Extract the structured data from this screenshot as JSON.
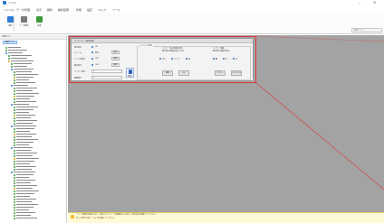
{
  "window": {
    "title": "ソフト",
    "minimize_glyph": "–",
    "close_glyph": "✕"
  },
  "menu": [
    "ファイル",
    "データ管理",
    "表示",
    "解析",
    "解析結果",
    "作図",
    "設定",
    "ヘルプ",
    "ツール"
  ],
  "ribbon": {
    "buttons": [
      {
        "label": "解析",
        "color": "#2e7bd6"
      },
      {
        "label": "データ確認",
        "color": "#7a7a7a"
      },
      {
        "label": "結果",
        "color": "#3c9a3c"
      }
    ],
    "right_box": "表示モード"
  },
  "tree": {
    "header": "全体モデル",
    "root_label": "解析モデル",
    "items": [
      {
        "indent": 2,
        "color": "#3c9a3c"
      },
      {
        "indent": 2,
        "color": "#3c9a3c"
      },
      {
        "indent": 2,
        "color": "#2e7bd6"
      },
      {
        "indent": 4,
        "color": "#3c9a3c"
      },
      {
        "indent": 4,
        "color": "#3c9a3c"
      },
      {
        "indent": 4,
        "color": "#d9a400"
      },
      {
        "indent": 6,
        "color": "#3c9a3c"
      },
      {
        "indent": 6,
        "color": "#3c9a3c"
      },
      {
        "indent": 6,
        "color": "#2e7bd6"
      },
      {
        "indent": 8,
        "color": "#3c9a3c"
      },
      {
        "indent": 8,
        "color": "#3c9a3c"
      },
      {
        "indent": 8,
        "color": "#d9a400"
      },
      {
        "indent": 8,
        "color": "#3c9a3c"
      },
      {
        "indent": 8,
        "color": "#3c9a3c"
      },
      {
        "indent": 6,
        "color": "#2e7bd6"
      },
      {
        "indent": 8,
        "color": "#3c9a3c"
      },
      {
        "indent": 8,
        "color": "#3c9a3c"
      },
      {
        "indent": 8,
        "color": "#3c9a3c"
      },
      {
        "indent": 8,
        "color": "#d9a400"
      },
      {
        "indent": 8,
        "color": "#3c9a3c"
      },
      {
        "indent": 8,
        "color": "#3c9a3c"
      },
      {
        "indent": 6,
        "color": "#2e7bd6"
      },
      {
        "indent": 8,
        "color": "#3c9a3c"
      },
      {
        "indent": 8,
        "color": "#3c9a3c"
      },
      {
        "indent": 8,
        "color": "#3c9a3c"
      },
      {
        "indent": 8,
        "color": "#d9a400"
      },
      {
        "indent": 8,
        "color": "#3c9a3c"
      },
      {
        "indent": 8,
        "color": "#3c9a3c"
      },
      {
        "indent": 8,
        "color": "#3c9a3c"
      },
      {
        "indent": 6,
        "color": "#2e7bd6"
      },
      {
        "indent": 8,
        "color": "#3c9a3c"
      },
      {
        "indent": 8,
        "color": "#3c9a3c"
      },
      {
        "indent": 8,
        "color": "#d9a400"
      },
      {
        "indent": 8,
        "color": "#3c9a3c"
      },
      {
        "indent": 8,
        "color": "#3c9a3c"
      },
      {
        "indent": 8,
        "color": "#3c9a3c"
      },
      {
        "indent": 8,
        "color": "#3c9a3c"
      },
      {
        "indent": 6,
        "color": "#2e7bd6"
      },
      {
        "indent": 8,
        "color": "#3c9a3c"
      },
      {
        "indent": 8,
        "color": "#3c9a3c"
      },
      {
        "indent": 8,
        "color": "#3c9a3c"
      },
      {
        "indent": 8,
        "color": "#d9a400"
      },
      {
        "indent": 8,
        "color": "#3c9a3c"
      },
      {
        "indent": 8,
        "color": "#3c9a3c"
      },
      {
        "indent": 8,
        "color": "#3c9a3c"
      },
      {
        "indent": 8,
        "color": "#3c9a3c"
      },
      {
        "indent": 6,
        "color": "#2e7bd6"
      },
      {
        "indent": 8,
        "color": "#3c9a3c"
      },
      {
        "indent": 8,
        "color": "#3c9a3c"
      },
      {
        "indent": 8,
        "color": "#3c9a3c"
      },
      {
        "indent": 8,
        "color": "#3c9a3c"
      },
      {
        "indent": 8,
        "color": "#3c9a3c"
      },
      {
        "indent": 8,
        "color": "#d9a400"
      },
      {
        "indent": 8,
        "color": "#3c9a3c"
      },
      {
        "indent": 8,
        "color": "#3c9a3c"
      },
      {
        "indent": 8,
        "color": "#3c9a3c"
      },
      {
        "indent": 8,
        "color": "#3c9a3c"
      },
      {
        "indent": 8,
        "color": "#3c9a3c"
      },
      {
        "indent": 8,
        "color": "#3c9a3c"
      },
      {
        "indent": 8,
        "color": "#3c9a3c"
      },
      {
        "indent": 8,
        "color": "#3c9a3c"
      },
      {
        "indent": 8,
        "color": "#3c9a3c"
      },
      {
        "indent": 8,
        "color": "#3c9a3c"
      },
      {
        "indent": 8,
        "color": "#3c9a3c"
      }
    ]
  },
  "dialog": {
    "title": "ワイヤフレーム表示設定",
    "rows": [
      {
        "label": "線の表示",
        "value": "ON",
        "button": ""
      },
      {
        "label": "フレーム",
        "value": "表示",
        "button": "設定"
      },
      {
        "label": "ワイヤの表示",
        "value": "OFF",
        "button": "設定"
      },
      {
        "label": "面の表示",
        "value": "OFF",
        "button": "設定"
      },
      {
        "label": "ワイヤー番号",
        "value": "",
        "button": ""
      },
      {
        "label": "要素番号",
        "value": "",
        "button": ""
      }
    ],
    "inputs": {
      "wire_number": "1",
      "element_number": "1"
    },
    "group_title": "ハイライト表示",
    "left_note": [
      "ワイヤーのみ 断面を表示",
      "面を表示 断面を表示します"
    ],
    "right_note": [
      "ワイヤー 断面",
      "面を表示 断面を表示"
    ],
    "radio_options_left": [
      "太さ",
      "ワイヤー",
      "面"
    ],
    "radio_options_right": [
      "細",
      "中",
      "太"
    ],
    "buttons": {
      "apply": "適用",
      "ok": "OK",
      "reset": "リセット",
      "cancel": "キャンセル",
      "big": "表示"
    }
  },
  "status": {
    "icon_glyph": "!",
    "lines": [
      "ツリーの項目を選択すると、該当するワイヤーが強調表示されます。表示設定を変更してください。",
      "詳しい操作方法は、ヘルプを参照してください。"
    ]
  }
}
